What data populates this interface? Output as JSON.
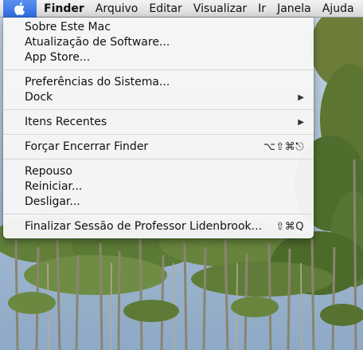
{
  "menubar": {
    "apple_icon": "apple-icon",
    "app_name": "Finder",
    "items": [
      {
        "label": "Arquivo"
      },
      {
        "label": "Editar"
      },
      {
        "label": "Visualizar"
      },
      {
        "label": "Ir"
      },
      {
        "label": "Janela"
      },
      {
        "label": "Ajuda"
      }
    ]
  },
  "apple_menu": {
    "groups": [
      [
        {
          "label": "Sobre Este Mac"
        },
        {
          "label": "Atualização de Software..."
        },
        {
          "label": "App Store..."
        }
      ],
      [
        {
          "label": "Preferências do Sistema..."
        },
        {
          "label": "Dock",
          "submenu_icon": "submenu-arrow-icon"
        }
      ],
      [
        {
          "label": "Itens Recentes",
          "submenu_icon": "submenu-arrow-icon"
        }
      ],
      [
        {
          "label": "Forçar Encerrar Finder",
          "shortcut": "⌥⇧⌘⎋"
        }
      ],
      [
        {
          "label": "Repouso"
        },
        {
          "label": "Reiniciar..."
        },
        {
          "label": "Desligar..."
        }
      ],
      [
        {
          "label": "Finalizar Sessão de Professor Lidenbrook...",
          "shortcut": "⇧⌘Q"
        }
      ]
    ]
  },
  "colors": {
    "menubar_highlight": "#2d6be0",
    "menu_background": "#f6f6f6",
    "separator": "#d7d7d7",
    "sky": "#9fb6cf",
    "foliage": "#4a6a2f"
  }
}
